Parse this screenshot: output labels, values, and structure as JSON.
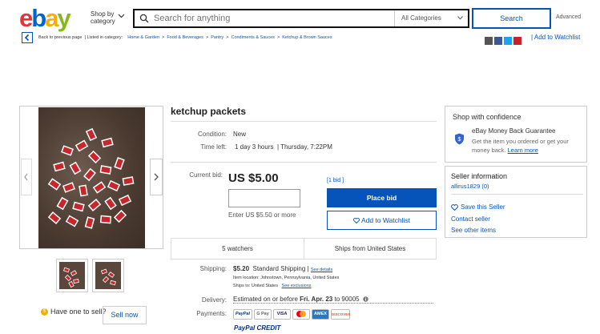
{
  "header": {
    "logo_letters": [
      "e",
      "b",
      "a",
      "y"
    ],
    "shop_by_line1": "Shop by",
    "shop_by_line2": "category",
    "search_placeholder": "Search for anything",
    "category_select": "All Categories",
    "search_button": "Search",
    "advanced": "Advanced"
  },
  "breadcrumb": {
    "back": "Back to previous page",
    "listed_in": "| Listed in category:",
    "items": [
      "Home & Garden",
      "Food & Beverages",
      "Pantry",
      "Condiments & Sauces",
      "Ketchup & Brown Sauces"
    ],
    "separator": ">",
    "add_to_watchlist": "| Add to Watchlist"
  },
  "listing": {
    "title": "ketchup packets",
    "condition_label": "Condition:",
    "condition_value": "New",
    "time_left_label": "Time left:",
    "time_left_value": "1 day 3 hours",
    "time_left_end": "| Thursday, 7:22PM",
    "current_bid_label": "Current bid:",
    "price": "US $5.00",
    "bid_count": "[1 bid ]",
    "bid_hint": "Enter US $5.50 or more",
    "place_bid": "Place bid",
    "add_to_watchlist": "Add to Watchlist",
    "watchers": "5 watchers",
    "ships_from": "Ships from United States",
    "shipping_label": "Shipping:",
    "shipping_price": "$5.20",
    "shipping_method": "Standard Shipping |",
    "see_details": "See details",
    "item_location": "Item location:  Johnstown, Pennsylvania, United States",
    "ships_to": "Ships to:  United States",
    "see_exclusions": "See exclusions",
    "delivery_label": "Delivery:",
    "delivery_prefix": "Estimated on or before",
    "delivery_date": "Fri. Apr. 23",
    "delivery_suffix": "to 90005",
    "payments_label": "Payments:",
    "payment_methods": [
      "PayPal",
      "G Pay",
      "VISA",
      "MC",
      "AMEX",
      "DISCOVER"
    ],
    "paypal_credit": "PayPal CREDIT"
  },
  "sell": {
    "prompt": "Have one to sell?",
    "button": "Sell now"
  },
  "confidence": {
    "title": "Shop with confidence",
    "guarantee_title": "eBay Money Back Guarantee",
    "guarantee_text": "Get the item you ordered or get your money back.",
    "learn_more": "Learn more"
  },
  "seller": {
    "title": "Seller information",
    "name": "allirus1829 (0)",
    "save": "Save this Seller",
    "contact": "Contact seller",
    "other_items": "See other items"
  },
  "colors": {
    "ebay_red": "#e53238",
    "ebay_blue": "#0064d2",
    "ebay_yellow": "#f5af02",
    "ebay_green": "#86b817",
    "link_blue": "#0654ba"
  }
}
